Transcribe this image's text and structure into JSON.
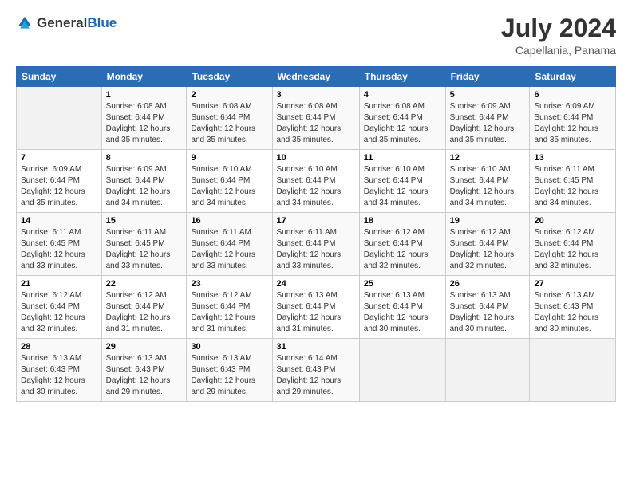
{
  "logo": {
    "general": "General",
    "blue": "Blue"
  },
  "title": "July 2024",
  "subtitle": "Capellania, Panama",
  "header": {
    "days": [
      "Sunday",
      "Monday",
      "Tuesday",
      "Wednesday",
      "Thursday",
      "Friday",
      "Saturday"
    ]
  },
  "weeks": [
    [
      {
        "day": "",
        "info": ""
      },
      {
        "day": "1",
        "info": "Sunrise: 6:08 AM\nSunset: 6:44 PM\nDaylight: 12 hours\nand 35 minutes."
      },
      {
        "day": "2",
        "info": "Sunrise: 6:08 AM\nSunset: 6:44 PM\nDaylight: 12 hours\nand 35 minutes."
      },
      {
        "day": "3",
        "info": "Sunrise: 6:08 AM\nSunset: 6:44 PM\nDaylight: 12 hours\nand 35 minutes."
      },
      {
        "day": "4",
        "info": "Sunrise: 6:08 AM\nSunset: 6:44 PM\nDaylight: 12 hours\nand 35 minutes."
      },
      {
        "day": "5",
        "info": "Sunrise: 6:09 AM\nSunset: 6:44 PM\nDaylight: 12 hours\nand 35 minutes."
      },
      {
        "day": "6",
        "info": "Sunrise: 6:09 AM\nSunset: 6:44 PM\nDaylight: 12 hours\nand 35 minutes."
      }
    ],
    [
      {
        "day": "7",
        "info": "Sunrise: 6:09 AM\nSunset: 6:44 PM\nDaylight: 12 hours\nand 35 minutes."
      },
      {
        "day": "8",
        "info": "Sunrise: 6:09 AM\nSunset: 6:44 PM\nDaylight: 12 hours\nand 34 minutes."
      },
      {
        "day": "9",
        "info": "Sunrise: 6:10 AM\nSunset: 6:44 PM\nDaylight: 12 hours\nand 34 minutes."
      },
      {
        "day": "10",
        "info": "Sunrise: 6:10 AM\nSunset: 6:44 PM\nDaylight: 12 hours\nand 34 minutes."
      },
      {
        "day": "11",
        "info": "Sunrise: 6:10 AM\nSunset: 6:44 PM\nDaylight: 12 hours\nand 34 minutes."
      },
      {
        "day": "12",
        "info": "Sunrise: 6:10 AM\nSunset: 6:44 PM\nDaylight: 12 hours\nand 34 minutes."
      },
      {
        "day": "13",
        "info": "Sunrise: 6:11 AM\nSunset: 6:45 PM\nDaylight: 12 hours\nand 34 minutes."
      }
    ],
    [
      {
        "day": "14",
        "info": "Sunrise: 6:11 AM\nSunset: 6:45 PM\nDaylight: 12 hours\nand 33 minutes."
      },
      {
        "day": "15",
        "info": "Sunrise: 6:11 AM\nSunset: 6:45 PM\nDaylight: 12 hours\nand 33 minutes."
      },
      {
        "day": "16",
        "info": "Sunrise: 6:11 AM\nSunset: 6:44 PM\nDaylight: 12 hours\nand 33 minutes."
      },
      {
        "day": "17",
        "info": "Sunrise: 6:11 AM\nSunset: 6:44 PM\nDaylight: 12 hours\nand 33 minutes."
      },
      {
        "day": "18",
        "info": "Sunrise: 6:12 AM\nSunset: 6:44 PM\nDaylight: 12 hours\nand 32 minutes."
      },
      {
        "day": "19",
        "info": "Sunrise: 6:12 AM\nSunset: 6:44 PM\nDaylight: 12 hours\nand 32 minutes."
      },
      {
        "day": "20",
        "info": "Sunrise: 6:12 AM\nSunset: 6:44 PM\nDaylight: 12 hours\nand 32 minutes."
      }
    ],
    [
      {
        "day": "21",
        "info": "Sunrise: 6:12 AM\nSunset: 6:44 PM\nDaylight: 12 hours\nand 32 minutes."
      },
      {
        "day": "22",
        "info": "Sunrise: 6:12 AM\nSunset: 6:44 PM\nDaylight: 12 hours\nand 31 minutes."
      },
      {
        "day": "23",
        "info": "Sunrise: 6:12 AM\nSunset: 6:44 PM\nDaylight: 12 hours\nand 31 minutes."
      },
      {
        "day": "24",
        "info": "Sunrise: 6:13 AM\nSunset: 6:44 PM\nDaylight: 12 hours\nand 31 minutes."
      },
      {
        "day": "25",
        "info": "Sunrise: 6:13 AM\nSunset: 6:44 PM\nDaylight: 12 hours\nand 30 minutes."
      },
      {
        "day": "26",
        "info": "Sunrise: 6:13 AM\nSunset: 6:44 PM\nDaylight: 12 hours\nand 30 minutes."
      },
      {
        "day": "27",
        "info": "Sunrise: 6:13 AM\nSunset: 6:43 PM\nDaylight: 12 hours\nand 30 minutes."
      }
    ],
    [
      {
        "day": "28",
        "info": "Sunrise: 6:13 AM\nSunset: 6:43 PM\nDaylight: 12 hours\nand 30 minutes."
      },
      {
        "day": "29",
        "info": "Sunrise: 6:13 AM\nSunset: 6:43 PM\nDaylight: 12 hours\nand 29 minutes."
      },
      {
        "day": "30",
        "info": "Sunrise: 6:13 AM\nSunset: 6:43 PM\nDaylight: 12 hours\nand 29 minutes."
      },
      {
        "day": "31",
        "info": "Sunrise: 6:14 AM\nSunset: 6:43 PM\nDaylight: 12 hours\nand 29 minutes."
      },
      {
        "day": "",
        "info": ""
      },
      {
        "day": "",
        "info": ""
      },
      {
        "day": "",
        "info": ""
      }
    ]
  ]
}
